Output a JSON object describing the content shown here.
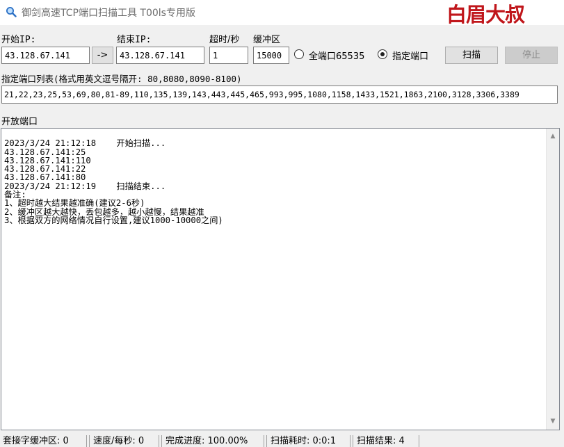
{
  "window": {
    "title": "御剑高速TCP端口扫描工具 T00ls专用版",
    "brand": "白眉大叔"
  },
  "form": {
    "start_ip_label": "开始IP:",
    "start_ip_value": "43.128.67.141",
    "copy_arrow_label": "->",
    "end_ip_label": "结束IP:",
    "end_ip_value": "43.128.67.141",
    "timeout_label": "超时/秒",
    "timeout_value": "1",
    "buffer_label": "缓冲区",
    "buffer_value": "15000",
    "all_ports_label": "全端口65535",
    "specified_ports_label": "指定端口",
    "selected_mode": "specified",
    "scan_button": "扫描",
    "stop_button": "停止",
    "port_list_label": "指定端口列表(格式用英文逗号隔开: 80,8080,8090-8100)",
    "port_list_value": "21,22,23,25,53,69,80,81-89,110,135,139,143,443,445,465,993,995,1080,1158,1433,1521,1863,2100,3128,3306,3389"
  },
  "open_ports": {
    "label": "开放端口",
    "log_lines": [
      "2023/3/24 21:12:18    开始扫描...",
      "43.128.67.141:25",
      "43.128.67.141:110",
      "43.128.67.141:22",
      "43.128.67.141:80",
      "2023/3/24 21:12:19    扫描结束...",
      "备注:",
      "1、超时越大结果越准确(建议2-6秒)",
      "2、缓冲区越大越快，丢包越多，越小越慢，结果越准",
      "3、根据双方的网络情况自行设置,建议1000-10000之间)"
    ]
  },
  "status": {
    "buffer": "套接字缓冲区: 0",
    "speed": "速度/每秒: 0",
    "progress": "完成进度: 100.00%",
    "elapsed": "扫描耗时: 0:0:1",
    "results": "扫描结果: 4"
  },
  "icons": {
    "title": "magnifier-icon",
    "scroll_up": "scroll-up-arrow-icon",
    "scroll_down": "scroll-down-arrow-icon"
  },
  "colors": {
    "brand": "#c0161b",
    "window_bg": "#f0f0f0"
  }
}
